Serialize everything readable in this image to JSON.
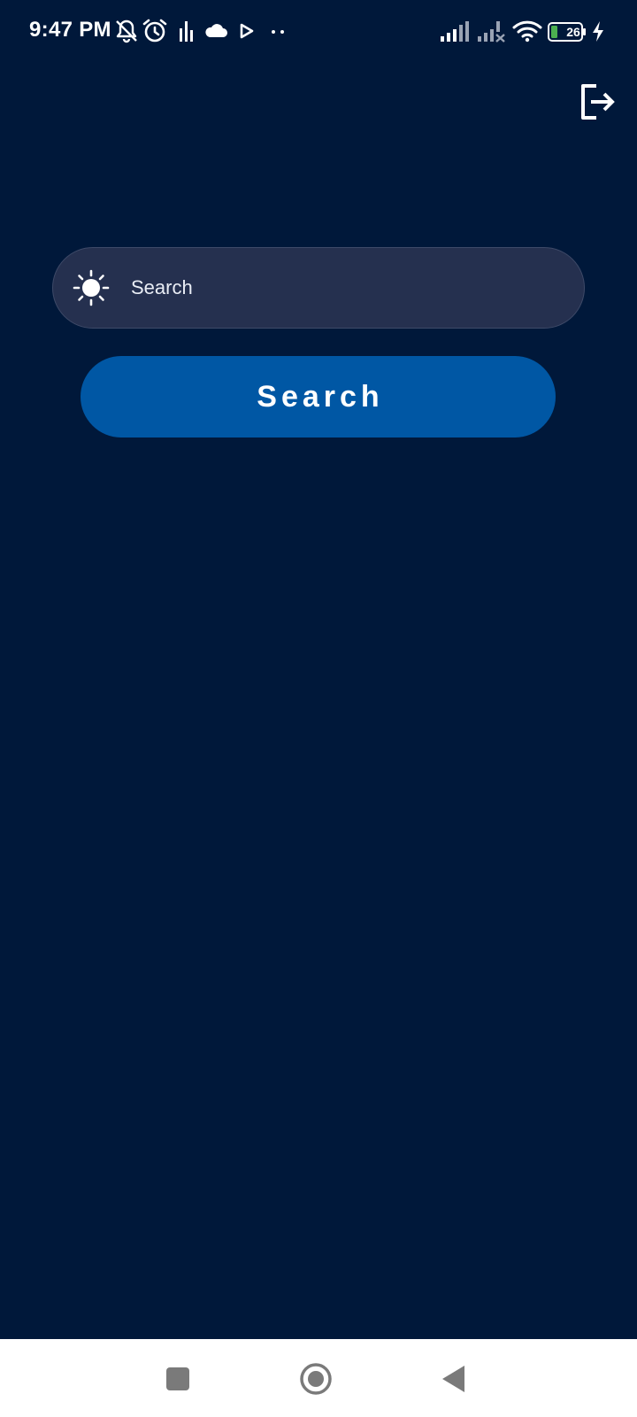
{
  "status_bar": {
    "time": "9:47 PM",
    "battery_level": "26",
    "battery_color": "#4caf50",
    "icons": [
      "notifications-off-icon",
      "alarm-icon",
      "equalizer-icon",
      "cloud-icon",
      "play-icon",
      "more-dots-icon",
      "signal-icon",
      "signal-no-service-icon",
      "wifi-icon",
      "battery-icon",
      "charging-icon"
    ]
  },
  "header": {
    "logout_icon": "logout-icon"
  },
  "search": {
    "placeholder": "Search",
    "value": "",
    "leading_icon": "sun-icon",
    "button_label": "Search"
  },
  "nav_bar": {
    "items": [
      "recents-square-icon",
      "home-circle-icon",
      "back-triangle-icon"
    ]
  },
  "colors": {
    "background": "#00183a",
    "input_background": "#25304f",
    "button_background": "#0057a4",
    "text": "#ffffff"
  }
}
